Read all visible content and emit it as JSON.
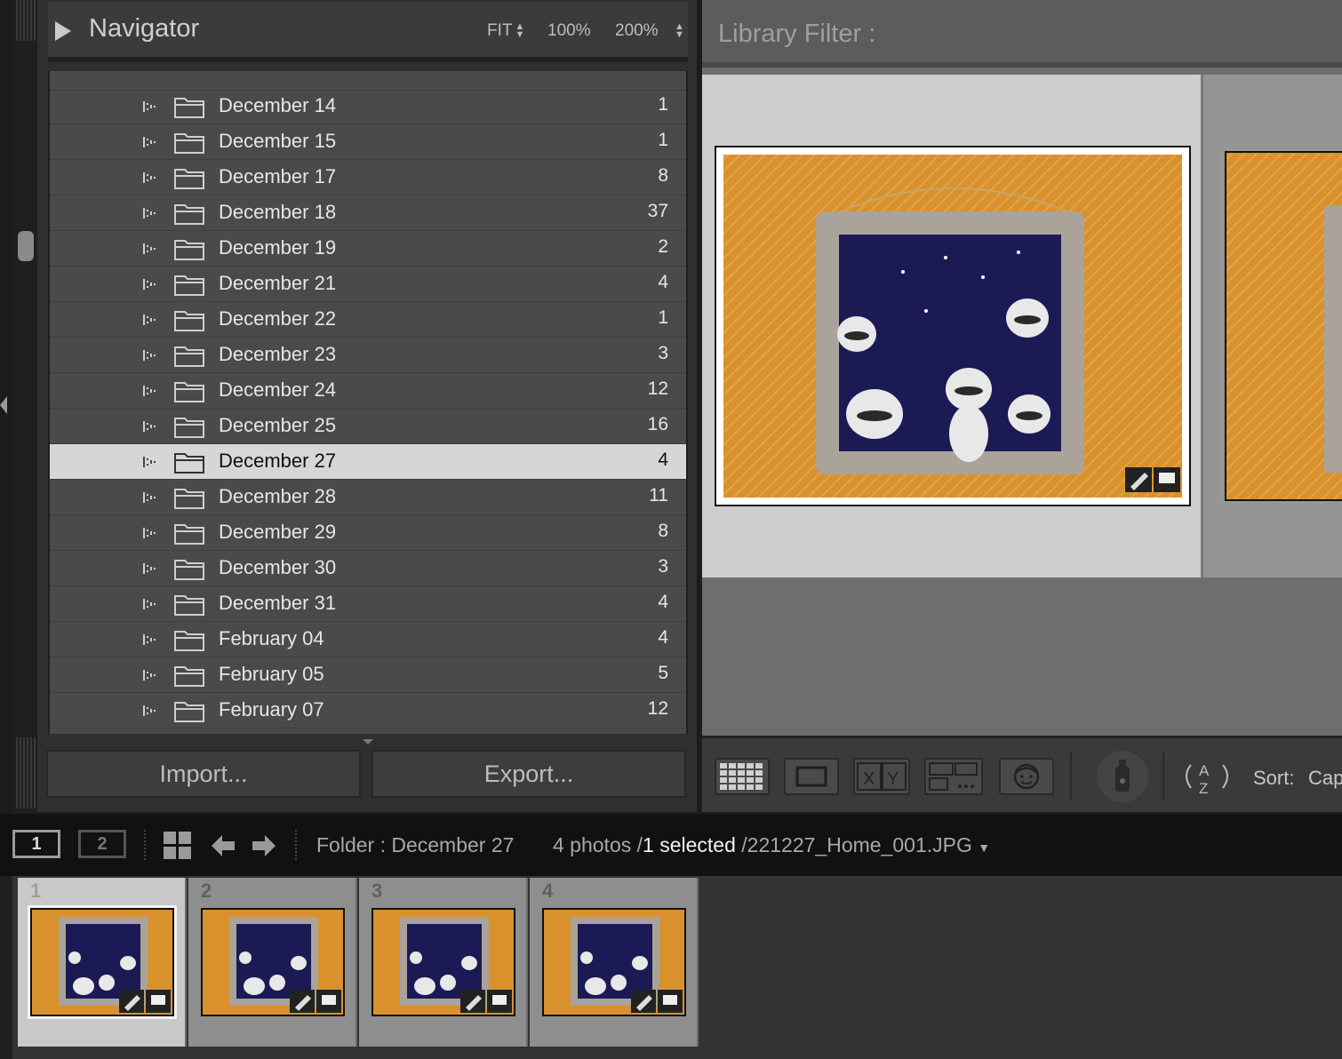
{
  "navigator": {
    "title": "Navigator",
    "zoom_fit": "FIT",
    "zoom_100": "100%",
    "zoom_200": "200%"
  },
  "folders": [
    {
      "name": "December 14",
      "count": "1"
    },
    {
      "name": "December 15",
      "count": "1"
    },
    {
      "name": "December 17",
      "count": "8"
    },
    {
      "name": "December 18",
      "count": "37"
    },
    {
      "name": "December 19",
      "count": "2"
    },
    {
      "name": "December 21",
      "count": "4"
    },
    {
      "name": "December 22",
      "count": "1"
    },
    {
      "name": "December 23",
      "count": "3"
    },
    {
      "name": "December 24",
      "count": "12"
    },
    {
      "name": "December 25",
      "count": "16"
    },
    {
      "name": "December 27",
      "count": "4",
      "selected": true
    },
    {
      "name": "December 28",
      "count": "11"
    },
    {
      "name": "December 29",
      "count": "8"
    },
    {
      "name": "December 30",
      "count": "3"
    },
    {
      "name": "December 31",
      "count": "4"
    },
    {
      "name": "February 04",
      "count": "4"
    },
    {
      "name": "February 05",
      "count": "5"
    },
    {
      "name": "February 07",
      "count": "12"
    }
  ],
  "buttons": {
    "import": "Import...",
    "export": "Export..."
  },
  "library_filter": {
    "label": "Library Filter :"
  },
  "toolbar": {
    "sort_label": "Sort:",
    "sort_value": "Cap"
  },
  "filmstrip_bar": {
    "screen_1": "1",
    "screen_2": "2",
    "breadcrumb": "Folder : December 27",
    "photos": "4 photos /",
    "selected": "1 selected",
    "filename": "/221227_Home_001.JPG"
  },
  "filmstrip": {
    "items": [
      {
        "num": "1",
        "selected": true
      },
      {
        "num": "2"
      },
      {
        "num": "3"
      },
      {
        "num": "4"
      }
    ]
  },
  "colors": {
    "selected_row": "#d6d6d6",
    "photo_orange": "#d9912e",
    "photo_navy": "#1c1a55"
  }
}
